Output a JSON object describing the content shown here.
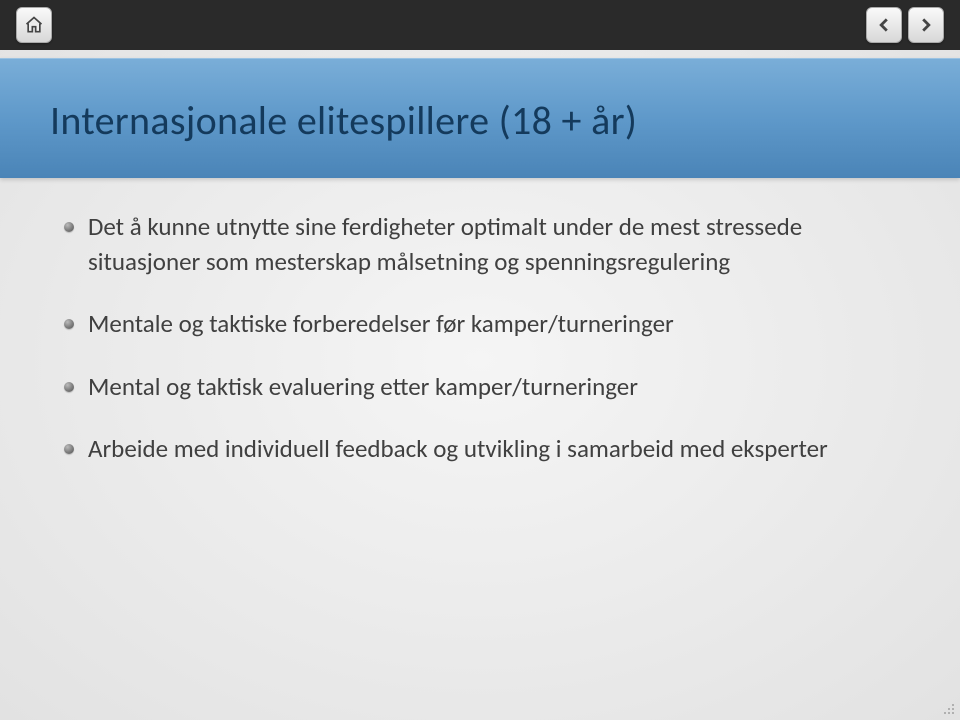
{
  "slide": {
    "title": "Internasjonale elitespillere (18 + år)",
    "bullets": [
      "Det å kunne utnytte sine ferdigheter optimalt under de mest stressede situasjoner som mesterskap målsetning og spenningsregulering",
      "Mentale og taktiske forberedelser før kamper/turneringer",
      "Mental og taktisk evaluering etter kamper/turneringer",
      "Arbeide med individuell feedback og utvikling i samarbeid med eksperter"
    ]
  },
  "nav": {
    "home": "home",
    "prev": "previous",
    "next": "next"
  }
}
